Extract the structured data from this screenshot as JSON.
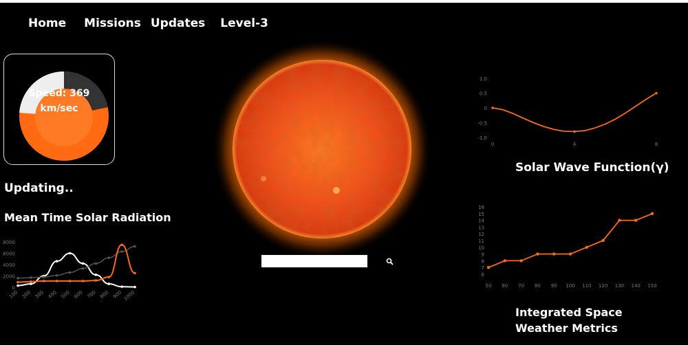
{
  "nav": {
    "home": "Home",
    "missions": "Missions",
    "updates": "Updates",
    "level": "Level-3"
  },
  "gauge": {
    "line1": "Speed: 369",
    "line2": "km/sec",
    "colors": {
      "primary": "#ff6a13",
      "secondary": "#333333",
      "tertiary": "#eeeeee",
      "inner": "#ff7a24"
    }
  },
  "status_text": "Updating..",
  "radiation_title": "Mean Time Solar Radiation",
  "wave_title": "Solar Wave Function(γ)",
  "metrics_title": "Integrated Space Weather Metrics",
  "search": {
    "placeholder": "",
    "icon": "search-icon"
  },
  "accent": "#ff6a13",
  "chart_data": [
    {
      "type": "line",
      "categories": [
        "100",
        "200",
        "300",
        "400",
        "500",
        "600",
        "700",
        "800",
        "900",
        "1000"
      ],
      "y_ticks": [
        "0",
        "2000",
        "4000",
        "6000",
        "8000"
      ],
      "ylim": [
        0,
        8000
      ],
      "series": [
        {
          "color": "#ffffff",
          "values": [
            300,
            600,
            2000,
            4600,
            6000,
            4200,
            2200,
            600,
            100,
            50
          ]
        },
        {
          "color": "#555555",
          "values": [
            1600,
            1700,
            1800,
            2100,
            2600,
            3300,
            4200,
            5200,
            6300,
            7200
          ]
        },
        {
          "color": "#ff6a13",
          "values": [
            900,
            1000,
            1100,
            1100,
            1100,
            1100,
            1200,
            1800,
            7500,
            2500
          ]
        }
      ]
    },
    {
      "type": "line",
      "x_ticks": [
        "0",
        "4",
        "8"
      ],
      "y_ticks": [
        "1.0",
        "0.5",
        "0",
        "-0.5",
        "-1.0"
      ],
      "xlim": [
        0,
        8
      ],
      "ylim": [
        -1,
        1
      ],
      "series": [
        {
          "color": "#ff6a13",
          "x": [
            0,
            0.5,
            1,
            1.5,
            2,
            2.5,
            3,
            3.5,
            4,
            4.5,
            5,
            5.5,
            6,
            6.5,
            7,
            7.5,
            8
          ],
          "values": [
            0,
            -0.06,
            -0.19,
            -0.35,
            -0.5,
            -0.63,
            -0.73,
            -0.79,
            -0.8,
            -0.77,
            -0.68,
            -0.55,
            -0.38,
            -0.17,
            0.06,
            0.29,
            0.5
          ]
        }
      ]
    },
    {
      "type": "line",
      "categories": [
        "50",
        "60",
        "70",
        "80",
        "90",
        "100",
        "110",
        "120",
        "130",
        "140",
        "150"
      ],
      "y_ticks": [
        "16",
        "15",
        "14",
        "13",
        "12",
        "11",
        "10",
        "9",
        "8",
        "7",
        "6"
      ],
      "ylim": [
        6,
        16
      ],
      "series": [
        {
          "color": "#ff6a13",
          "values": [
            7,
            8,
            8,
            9,
            9,
            9,
            10,
            11,
            14,
            14,
            15
          ]
        }
      ]
    }
  ]
}
